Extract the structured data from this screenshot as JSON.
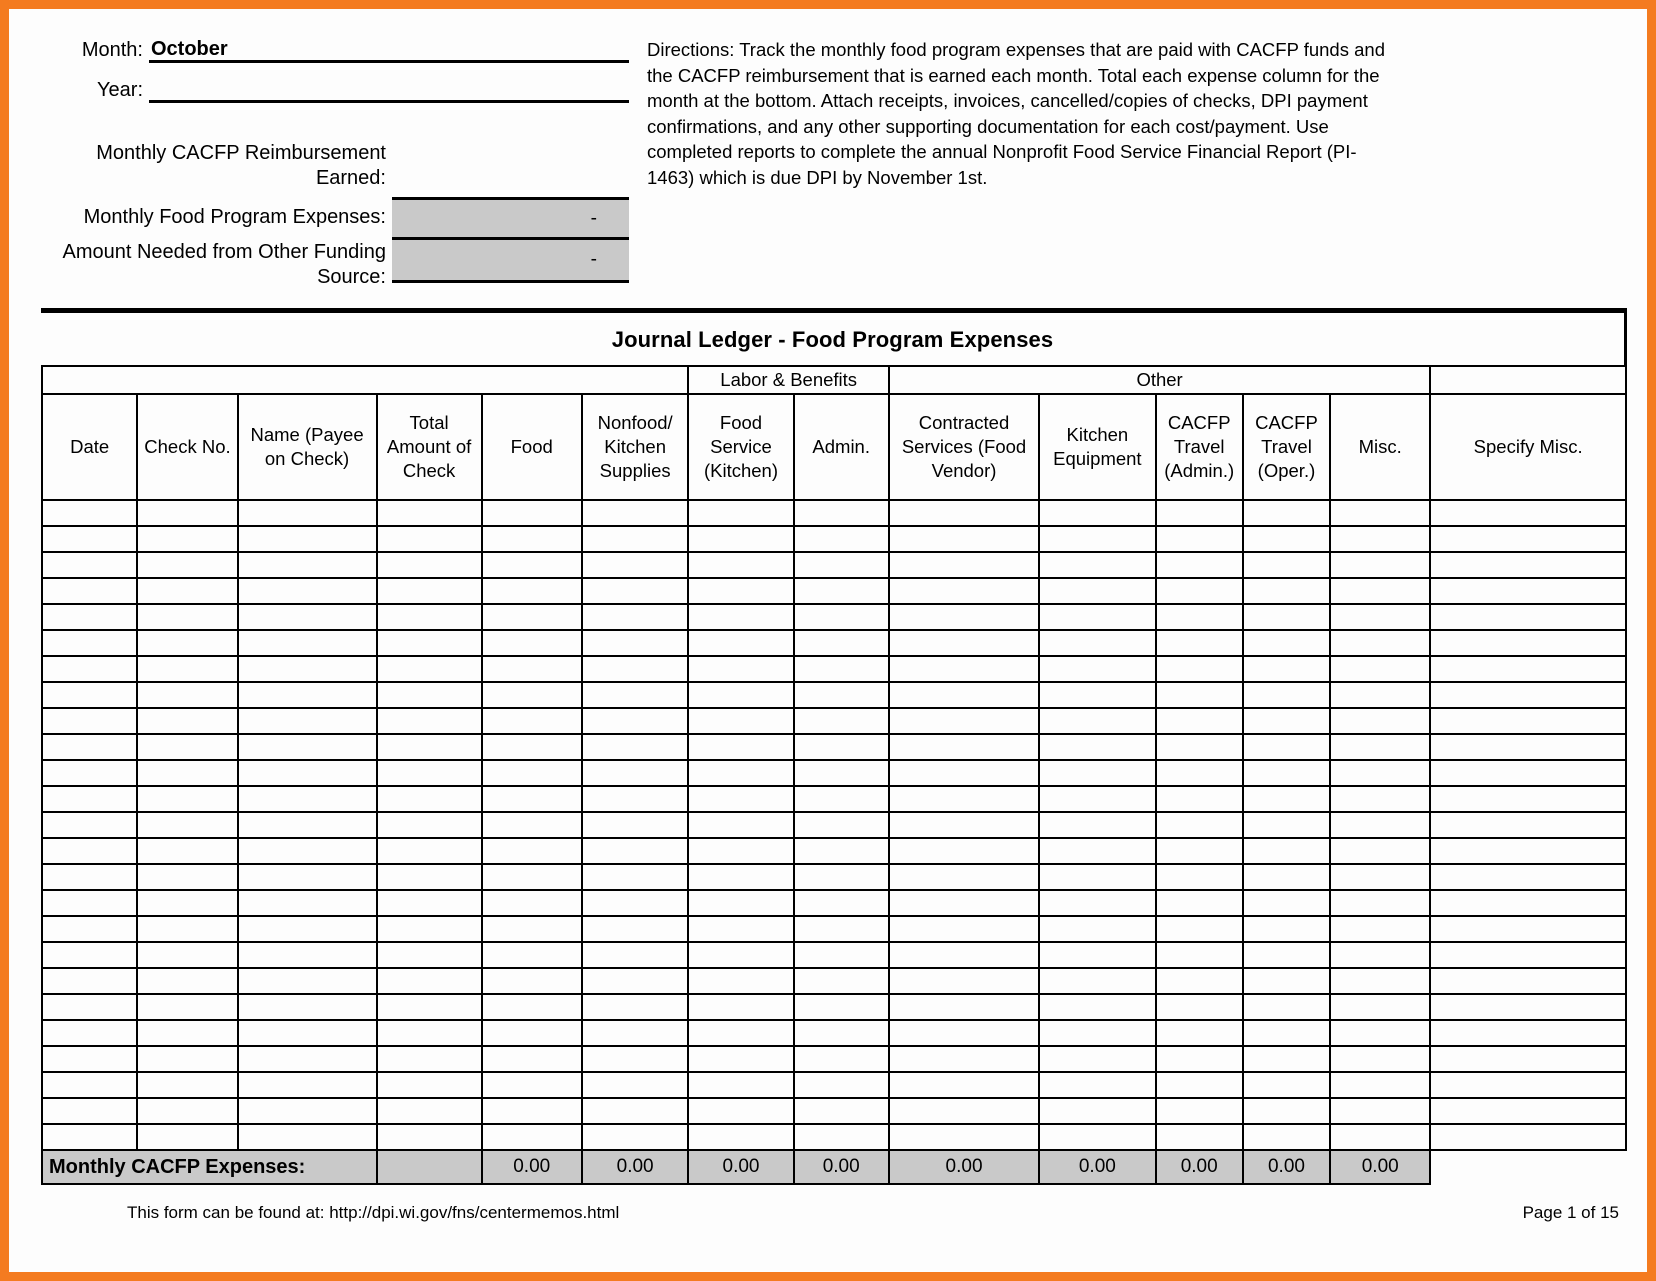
{
  "form": {
    "month_label": "Month:",
    "month_value": "October",
    "year_label": "Year:",
    "year_value": "",
    "reimbursement_label": "Monthly CACFP Reimbursement\nEarned:",
    "reimbursement_value": "",
    "food_expenses_label": "Monthly Food Program Expenses:",
    "food_expenses_value": "-",
    "other_funding_label": "Amount Needed from Other\nFunding Source:",
    "other_funding_value": "-"
  },
  "directions": {
    "text": "Directions: Track the monthly food program expenses that are paid with CACFP funds and the CACFP reimbursement that is earned each month. Total each expense column for the month at the bottom. Attach receipts, invoices, cancelled/copies of checks, DPI payment confirmations, and any other supporting documentation for each cost/payment. Use completed reports to complete  the annual Nonprofit Food Service Financial Report (PI-1463) which is due DPI by November 1st."
  },
  "ledger": {
    "title": "Journal Ledger - Food Program Expenses",
    "group_headers": [
      {
        "label": "",
        "span": 6
      },
      {
        "label": "Labor & Benefits",
        "span": 2
      },
      {
        "label": "Other",
        "span": 5
      },
      {
        "label": "",
        "span": 1
      }
    ],
    "columns": [
      "Date",
      "Check No.",
      "Name\n(Payee on\nCheck)",
      "Total\nAmount of\nCheck",
      "Food",
      "Nonfood/\nKitchen\nSupplies",
      "Food\nService\n(Kitchen)",
      "Admin.",
      "Contracted\nServices\n(Food Vendor)",
      "Kitchen\nEquipment",
      "CACFP\nTravel\n(Admin.)",
      "CACFP\nTravel\n(Oper.)",
      "Misc.",
      "Specify Misc."
    ],
    "row_count": 25,
    "totals": {
      "label": "Monthly CACFP Expenses:",
      "total_amount_of_check": "",
      "values": [
        "0.00",
        "0.00",
        "0.00",
        "0.00",
        "0.00",
        "0.00",
        "0.00",
        "0.00",
        "0.00"
      ],
      "specify_misc": ""
    }
  },
  "footer": {
    "source": "This form can be found at: http://dpi.wi.gov/fns/centermemos.html",
    "page": "Page 1 of 15"
  },
  "colors": {
    "border_accent": "#F47B20",
    "shaded_cell": "#c9c9c9"
  }
}
